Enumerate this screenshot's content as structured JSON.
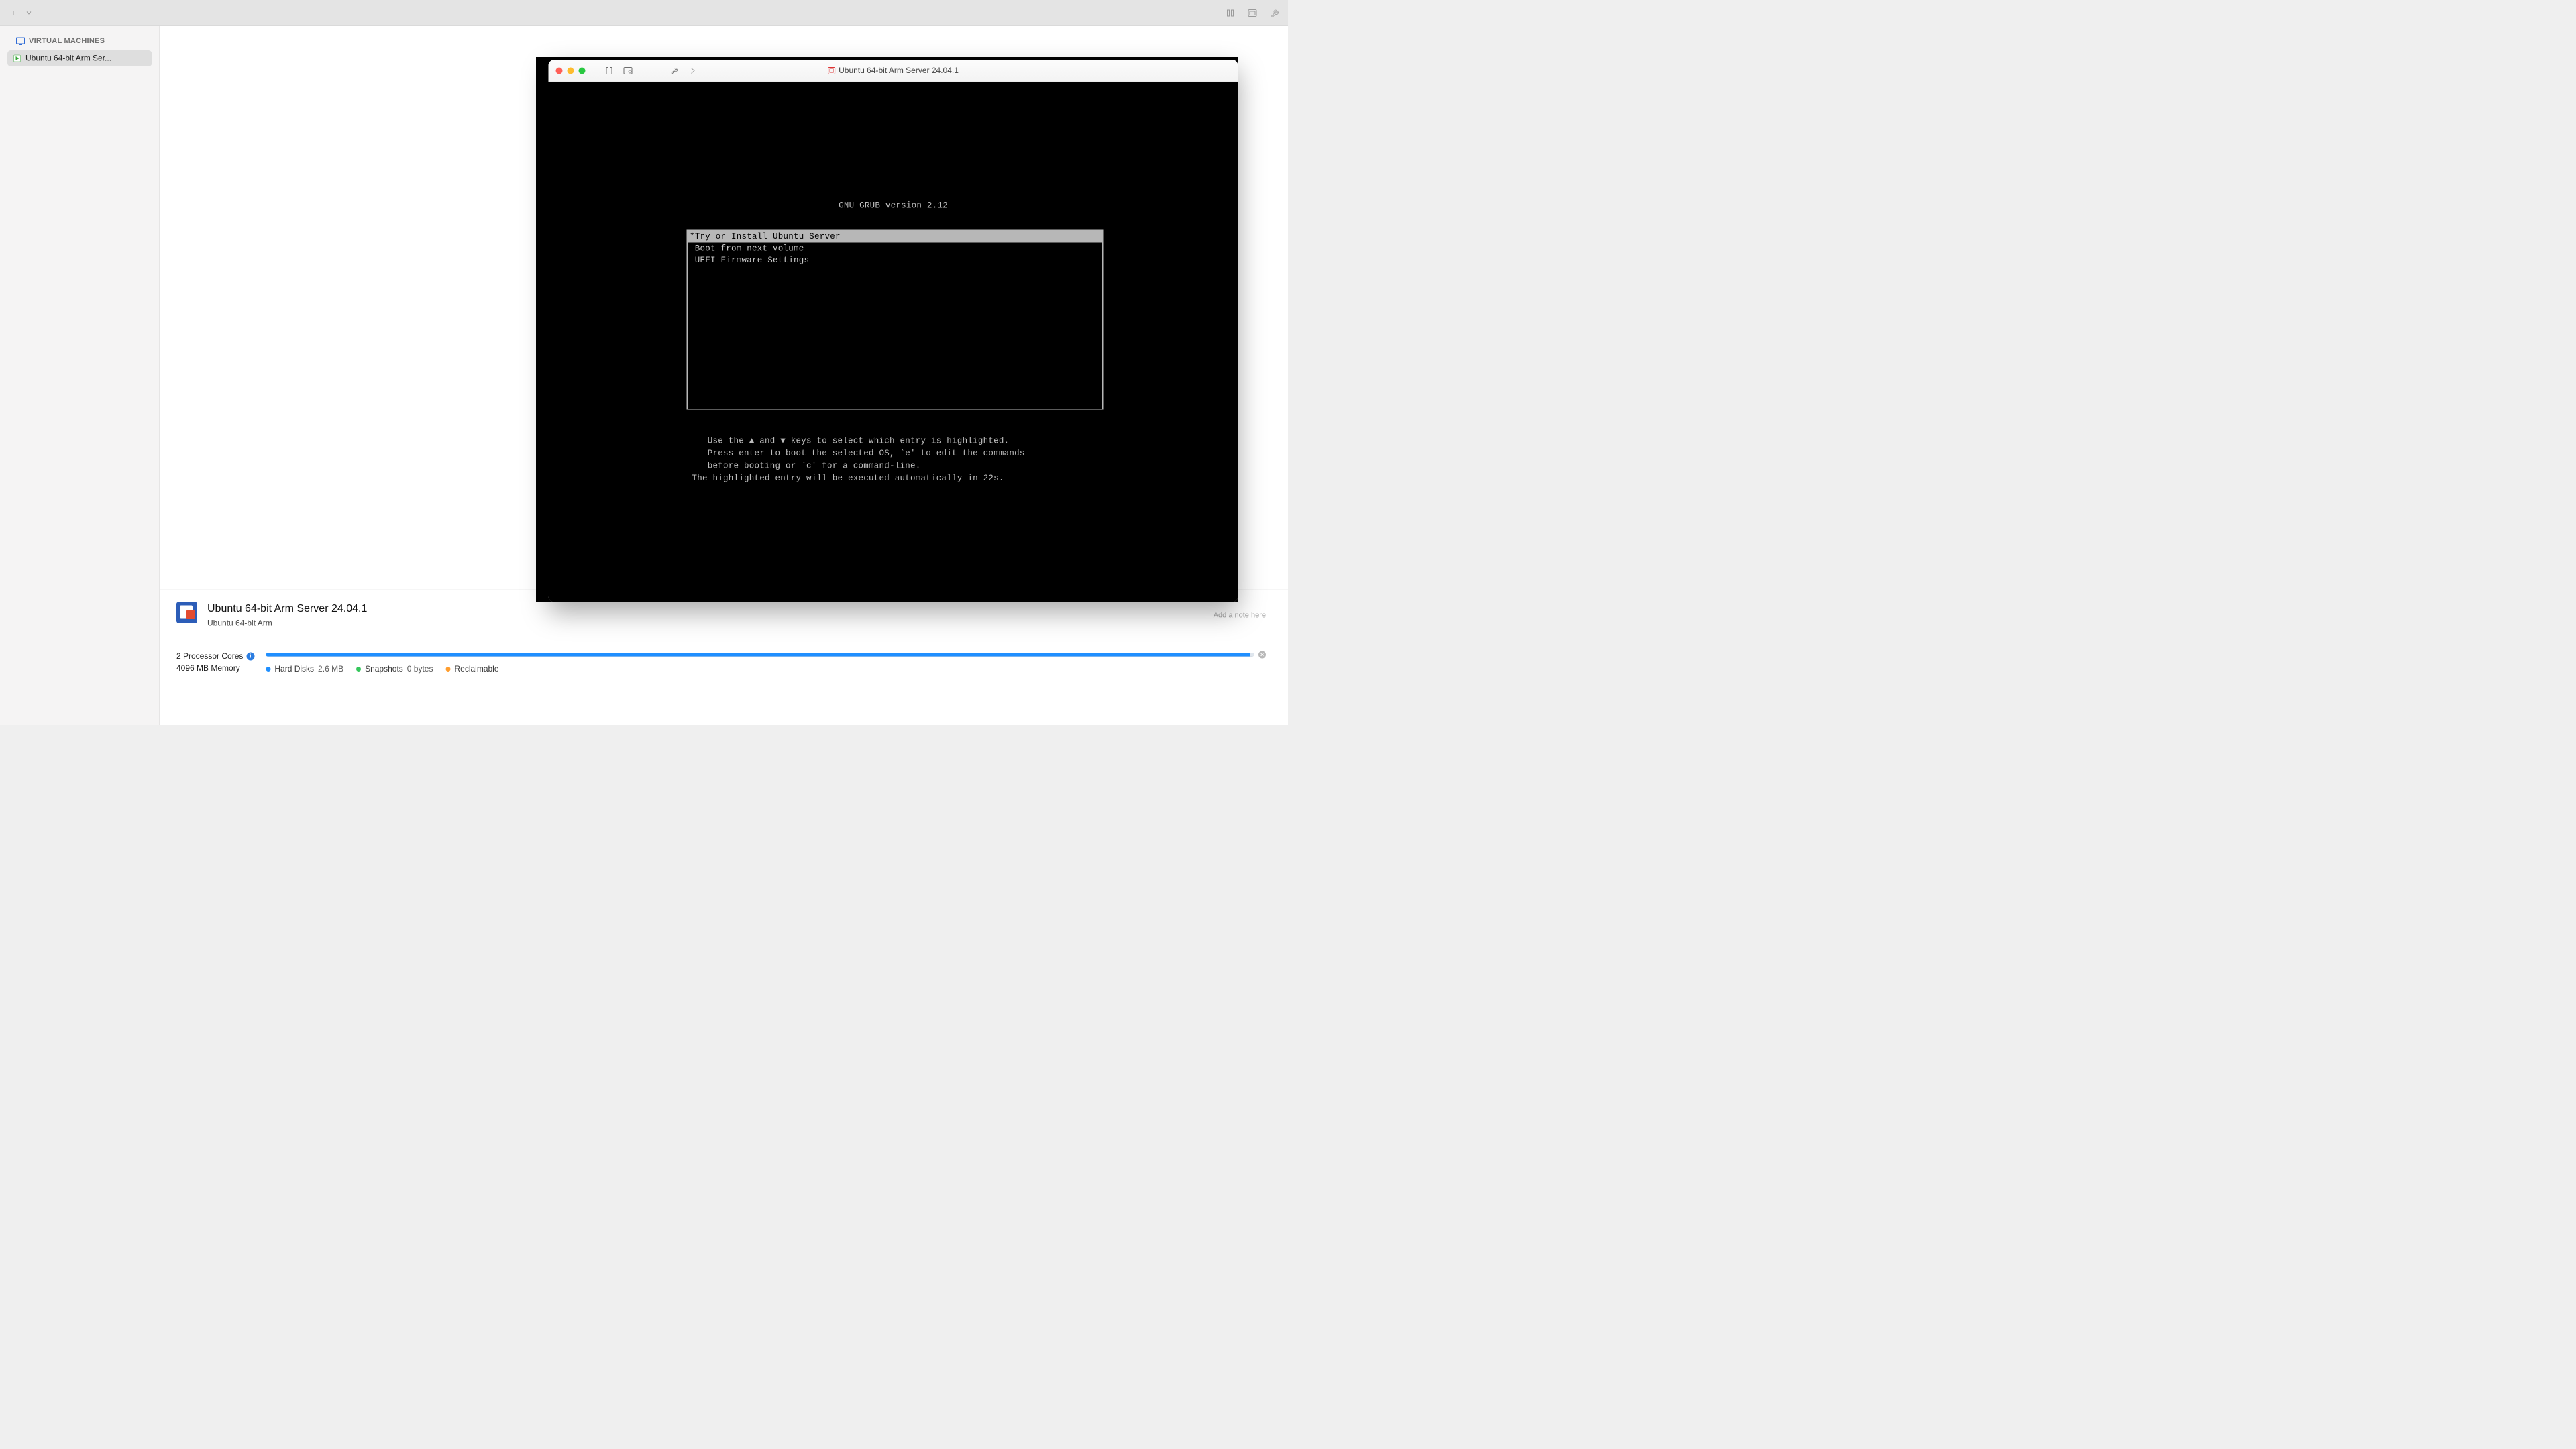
{
  "toolbar": {
    "add_label": "+"
  },
  "sidebar": {
    "header": "VIRTUAL MACHINES",
    "items": [
      {
        "label": "Ubuntu 64-bit Arm Ser...",
        "selected": true
      }
    ]
  },
  "mac_window": {
    "title": "Ubuntu 64-bit Arm Server 24.04.1"
  },
  "grub": {
    "title": "GNU GRUB  version 2.12",
    "entries": [
      {
        "label": "*Try or Install Ubuntu Server",
        "selected": true
      },
      {
        "label": " Boot from next volume",
        "selected": false
      },
      {
        "label": " UEFI Firmware Settings",
        "selected": false
      }
    ],
    "hint": "   Use the ▲ and ▼ keys to select which entry is highlighted.\n   Press enter to boot the selected OS, `e' to edit the commands\n   before booting or `c' for a command-line.\nThe highlighted entry will be executed automatically in 22s."
  },
  "vm_panel": {
    "title": "Ubuntu 64-bit Arm Server 24.04.1",
    "subtitle": "Ubuntu 64-bit Arm",
    "note_placeholder": "Add a note here",
    "cores_label": "2 Processor Cores",
    "memory_label": "4096 MB Memory",
    "legend": {
      "hd_label": "Hard Disks",
      "hd_value": "2.6 MB",
      "snap_label": "Snapshots",
      "snap_value": "0 bytes",
      "reclaim_label": "Reclaimable"
    }
  }
}
